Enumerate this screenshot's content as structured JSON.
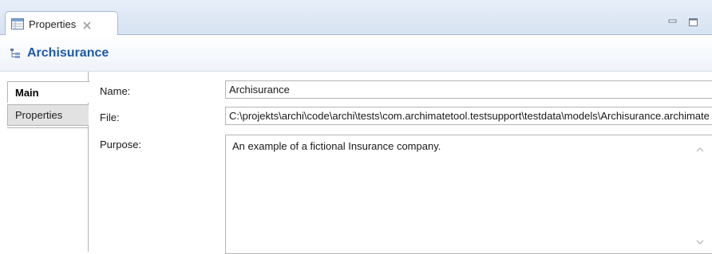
{
  "view_tab": {
    "label": "Properties",
    "icon": "properties-table-icon",
    "close_icon": "close-icon"
  },
  "window_controls": [
    "minimize-icon",
    "maximize-icon"
  ],
  "header": {
    "title": "Archisurance",
    "icon": "model-tree-icon",
    "title_color": "#1e5aa8"
  },
  "side_tabs": [
    {
      "label": "Main",
      "selected": true
    },
    {
      "label": "Properties",
      "selected": false
    }
  ],
  "form": {
    "name_label": "Name:",
    "name_value": "Archisurance",
    "file_label": "File:",
    "file_value": "C:\\projekts\\archi\\code\\archi\\tests\\com.archimatetool.testsupport\\testdata\\models\\Archisurance.archimate",
    "purpose_label": "Purpose:",
    "purpose_value": "An example of a fictional Insurance company."
  }
}
